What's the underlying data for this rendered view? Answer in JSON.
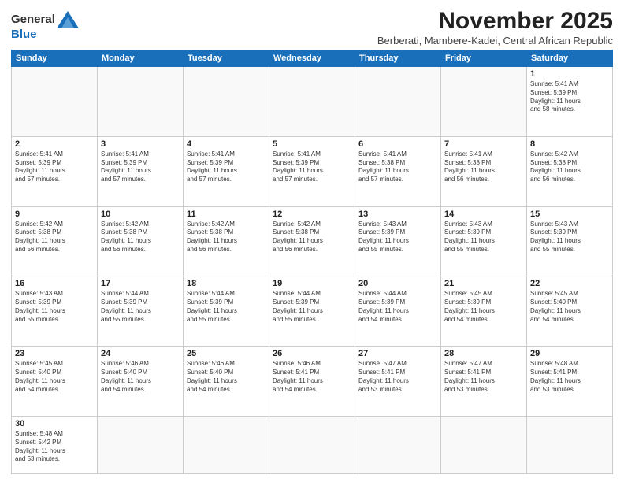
{
  "header": {
    "logo_line1": "General",
    "logo_line2": "Blue",
    "month_title": "November 2025",
    "subtitle": "Berberati, Mambere-Kadei, Central African Republic"
  },
  "days_of_week": [
    "Sunday",
    "Monday",
    "Tuesday",
    "Wednesday",
    "Thursday",
    "Friday",
    "Saturday"
  ],
  "weeks": [
    [
      {
        "day": "",
        "info": ""
      },
      {
        "day": "",
        "info": ""
      },
      {
        "day": "",
        "info": ""
      },
      {
        "day": "",
        "info": ""
      },
      {
        "day": "",
        "info": ""
      },
      {
        "day": "",
        "info": ""
      },
      {
        "day": "1",
        "info": "Sunrise: 5:41 AM\nSunset: 5:39 PM\nDaylight: 11 hours\nand 58 minutes."
      }
    ],
    [
      {
        "day": "2",
        "info": "Sunrise: 5:41 AM\nSunset: 5:39 PM\nDaylight: 11 hours\nand 57 minutes."
      },
      {
        "day": "3",
        "info": "Sunrise: 5:41 AM\nSunset: 5:39 PM\nDaylight: 11 hours\nand 57 minutes."
      },
      {
        "day": "4",
        "info": "Sunrise: 5:41 AM\nSunset: 5:39 PM\nDaylight: 11 hours\nand 57 minutes."
      },
      {
        "day": "5",
        "info": "Sunrise: 5:41 AM\nSunset: 5:39 PM\nDaylight: 11 hours\nand 57 minutes."
      },
      {
        "day": "6",
        "info": "Sunrise: 5:41 AM\nSunset: 5:38 PM\nDaylight: 11 hours\nand 57 minutes."
      },
      {
        "day": "7",
        "info": "Sunrise: 5:41 AM\nSunset: 5:38 PM\nDaylight: 11 hours\nand 56 minutes."
      },
      {
        "day": "8",
        "info": "Sunrise: 5:42 AM\nSunset: 5:38 PM\nDaylight: 11 hours\nand 56 minutes."
      }
    ],
    [
      {
        "day": "9",
        "info": "Sunrise: 5:42 AM\nSunset: 5:38 PM\nDaylight: 11 hours\nand 56 minutes."
      },
      {
        "day": "10",
        "info": "Sunrise: 5:42 AM\nSunset: 5:38 PM\nDaylight: 11 hours\nand 56 minutes."
      },
      {
        "day": "11",
        "info": "Sunrise: 5:42 AM\nSunset: 5:38 PM\nDaylight: 11 hours\nand 56 minutes."
      },
      {
        "day": "12",
        "info": "Sunrise: 5:42 AM\nSunset: 5:38 PM\nDaylight: 11 hours\nand 56 minutes."
      },
      {
        "day": "13",
        "info": "Sunrise: 5:43 AM\nSunset: 5:39 PM\nDaylight: 11 hours\nand 55 minutes."
      },
      {
        "day": "14",
        "info": "Sunrise: 5:43 AM\nSunset: 5:39 PM\nDaylight: 11 hours\nand 55 minutes."
      },
      {
        "day": "15",
        "info": "Sunrise: 5:43 AM\nSunset: 5:39 PM\nDaylight: 11 hours\nand 55 minutes."
      }
    ],
    [
      {
        "day": "16",
        "info": "Sunrise: 5:43 AM\nSunset: 5:39 PM\nDaylight: 11 hours\nand 55 minutes."
      },
      {
        "day": "17",
        "info": "Sunrise: 5:44 AM\nSunset: 5:39 PM\nDaylight: 11 hours\nand 55 minutes."
      },
      {
        "day": "18",
        "info": "Sunrise: 5:44 AM\nSunset: 5:39 PM\nDaylight: 11 hours\nand 55 minutes."
      },
      {
        "day": "19",
        "info": "Sunrise: 5:44 AM\nSunset: 5:39 PM\nDaylight: 11 hours\nand 55 minutes."
      },
      {
        "day": "20",
        "info": "Sunrise: 5:44 AM\nSunset: 5:39 PM\nDaylight: 11 hours\nand 54 minutes."
      },
      {
        "day": "21",
        "info": "Sunrise: 5:45 AM\nSunset: 5:39 PM\nDaylight: 11 hours\nand 54 minutes."
      },
      {
        "day": "22",
        "info": "Sunrise: 5:45 AM\nSunset: 5:40 PM\nDaylight: 11 hours\nand 54 minutes."
      }
    ],
    [
      {
        "day": "23",
        "info": "Sunrise: 5:45 AM\nSunset: 5:40 PM\nDaylight: 11 hours\nand 54 minutes."
      },
      {
        "day": "24",
        "info": "Sunrise: 5:46 AM\nSunset: 5:40 PM\nDaylight: 11 hours\nand 54 minutes."
      },
      {
        "day": "25",
        "info": "Sunrise: 5:46 AM\nSunset: 5:40 PM\nDaylight: 11 hours\nand 54 minutes."
      },
      {
        "day": "26",
        "info": "Sunrise: 5:46 AM\nSunset: 5:41 PM\nDaylight: 11 hours\nand 54 minutes."
      },
      {
        "day": "27",
        "info": "Sunrise: 5:47 AM\nSunset: 5:41 PM\nDaylight: 11 hours\nand 53 minutes."
      },
      {
        "day": "28",
        "info": "Sunrise: 5:47 AM\nSunset: 5:41 PM\nDaylight: 11 hours\nand 53 minutes."
      },
      {
        "day": "29",
        "info": "Sunrise: 5:48 AM\nSunset: 5:41 PM\nDaylight: 11 hours\nand 53 minutes."
      }
    ],
    [
      {
        "day": "30",
        "info": "Sunrise: 5:48 AM\nSunset: 5:42 PM\nDaylight: 11 hours\nand 53 minutes."
      },
      {
        "day": "",
        "info": ""
      },
      {
        "day": "",
        "info": ""
      },
      {
        "day": "",
        "info": ""
      },
      {
        "day": "",
        "info": ""
      },
      {
        "day": "",
        "info": ""
      },
      {
        "day": "",
        "info": ""
      }
    ]
  ]
}
